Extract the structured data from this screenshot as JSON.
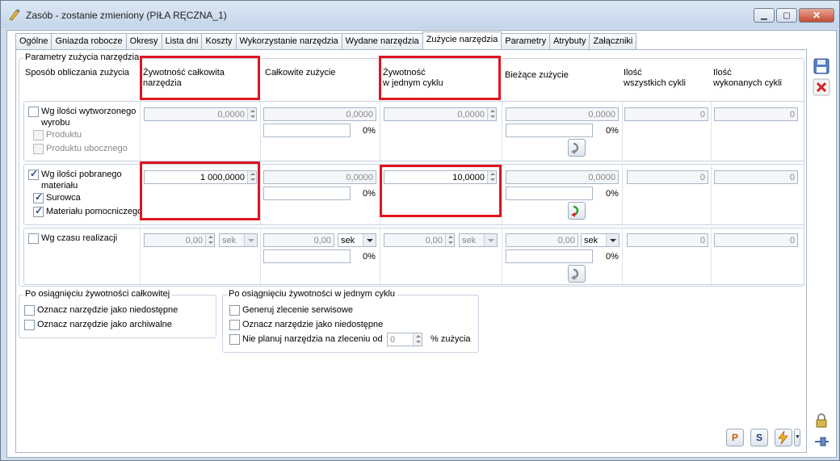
{
  "window": {
    "title": "Zasób - zostanie zmieniony  (PIŁA RĘCZNA_1)"
  },
  "tabs": [
    "Ogólne",
    "Gniazda robocze",
    "Okresy",
    "Lista dni",
    "Koszty",
    "Wykorzystanie narzędzia",
    "Wydane narzędzia",
    "Zużycie narzędzia",
    "Parametry",
    "Atrybuty",
    "Załączniki"
  ],
  "active_tab": "Zużycie narzędzia",
  "params": {
    "group_title": "Parametry zużycia narzędzia",
    "col_method": "Sposób obliczania zużycia",
    "col_total_life_1": "Żywotność całkowita",
    "col_total_life_2": "narzędzia",
    "col_total_usage": "Całkowite zużycie",
    "col_cycle_life_1": "Żywotność",
    "col_cycle_life_2": "w jednym cyklu",
    "col_current": "Bieżące zużycie",
    "col_all_cycles_1": "Ilość",
    "col_all_cycles_2": "wszystkich cykli",
    "col_done_cycles_1": "Ilość",
    "col_done_cycles_2": "wykonanych cykli"
  },
  "row1": {
    "label_1": "Wg ilości wytworzonego",
    "label_2": "wyrobu",
    "sub1": "Produktu",
    "sub2": "Produktu ubocznego",
    "total_life": "0,0000",
    "total_usage": "0,0000",
    "total_pct": "0%",
    "cycle_life": "0,0000",
    "current": "0,0000",
    "current_pct": "0%",
    "all_cycles": "0",
    "done_cycles": "0"
  },
  "row2": {
    "label_1": "Wg ilości pobranego",
    "label_2": "materiału",
    "sub1": "Surowca",
    "sub2": "Materiału pomocniczego",
    "total_life": "1 000,0000",
    "total_usage": "0,0000",
    "total_pct": "0%",
    "cycle_life": "10,0000",
    "current": "0,0000",
    "current_pct": "0%",
    "all_cycles": "0",
    "done_cycles": "0"
  },
  "row3": {
    "label": "Wg czasu realizacji",
    "total_life": "0,00",
    "total_unit": "sek",
    "total_usage": "0,00",
    "total_usage_unit": "sek",
    "total_pct": "0%",
    "cycle_life": "0,00",
    "cycle_unit": "sek",
    "current": "0,00",
    "current_unit": "sek",
    "current_pct": "0%",
    "all_cycles": "0",
    "done_cycles": "0"
  },
  "after_total": {
    "title": "Po osiągnięciu żywotności całkowitej",
    "opt1": "Oznacz narzędzie jako niedostępne",
    "opt2": "Oznacz narzędzie jako archiwalne"
  },
  "after_cycle": {
    "title": "Po osiągnięciu żywotności w jednym cyklu",
    "opt1": "Generuj zlecenie serwisowe",
    "opt2": "Oznacz narzędzie jako niedostępne",
    "opt3": "Nie planuj narzędzia na zleceniu od",
    "percent_value": "0",
    "percent_label": "% zużycia"
  },
  "bottom_buttons": {
    "p": "P",
    "s": "S"
  },
  "colors": {
    "highlight_red": "#e0141e",
    "title_bar": "#c4d5ea"
  }
}
